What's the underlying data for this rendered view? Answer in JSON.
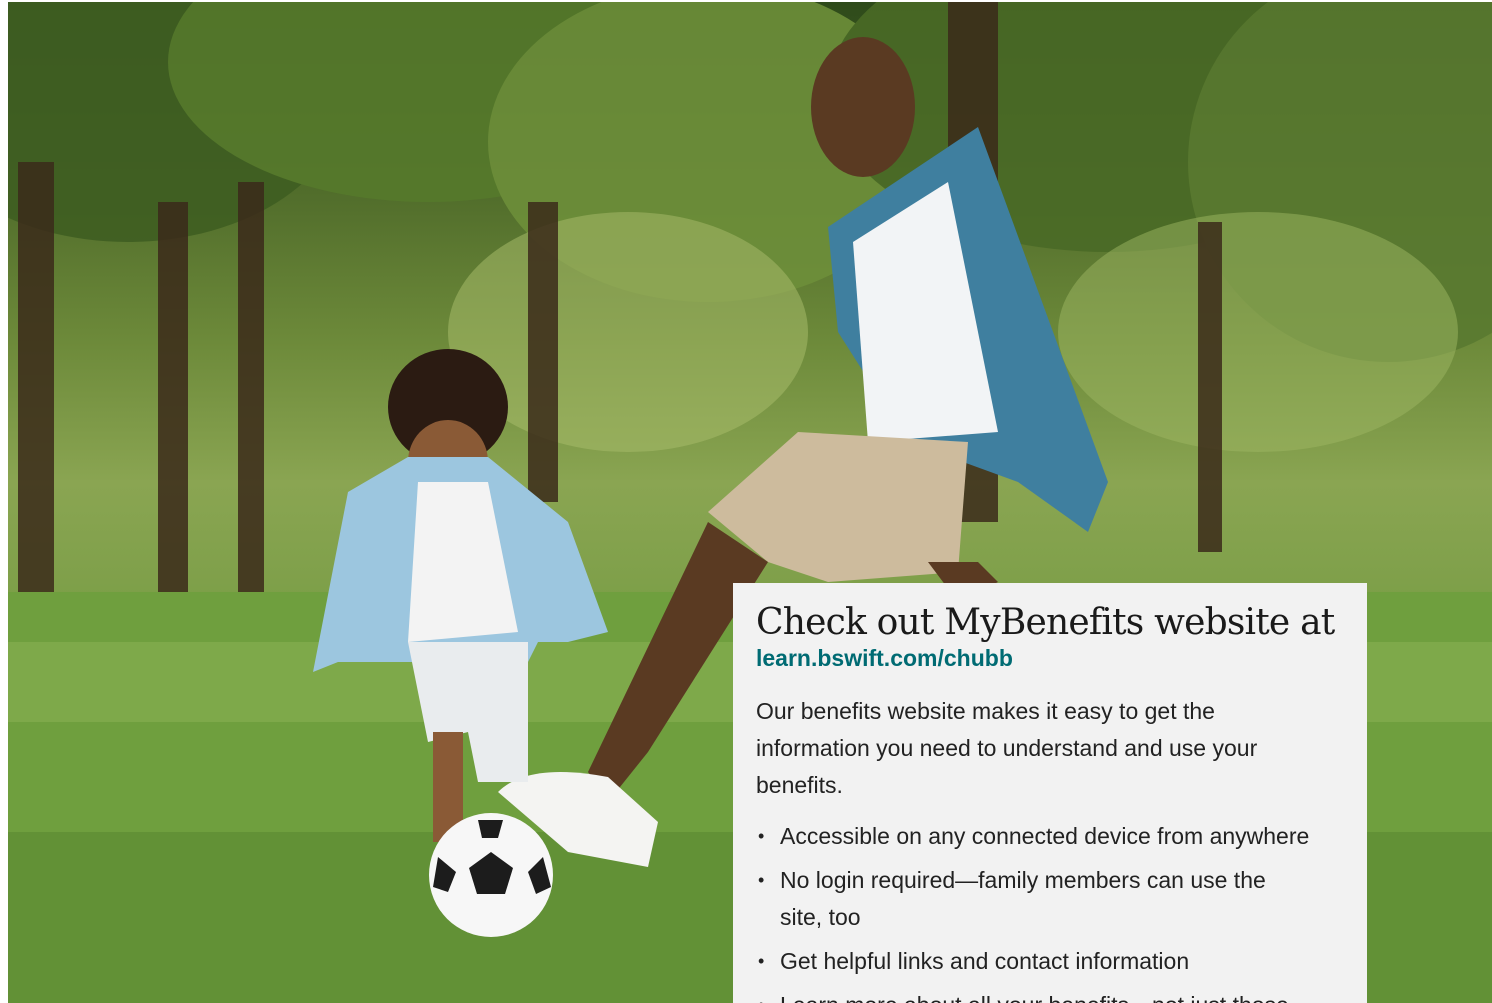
{
  "card": {
    "title": "Check out MyBenefits website at",
    "link": "learn.bswift.com/chubb",
    "intro": "Our benefits website makes it easy to get the information you need to understand and use your benefits.",
    "bullets": [
      "Accessible on any connected device from anywhere",
      "No login required—family members can use the site, too",
      "Get helpful links and contact information",
      "Learn more about all your benefits—not just those"
    ],
    "bullet_glyph": "•"
  },
  "colors": {
    "link": "#006b73",
    "card_background": "#f2f2f2",
    "text": "#222222"
  },
  "hero": {
    "icon": "photo-father-and-son-playing-soccer-in-park"
  }
}
